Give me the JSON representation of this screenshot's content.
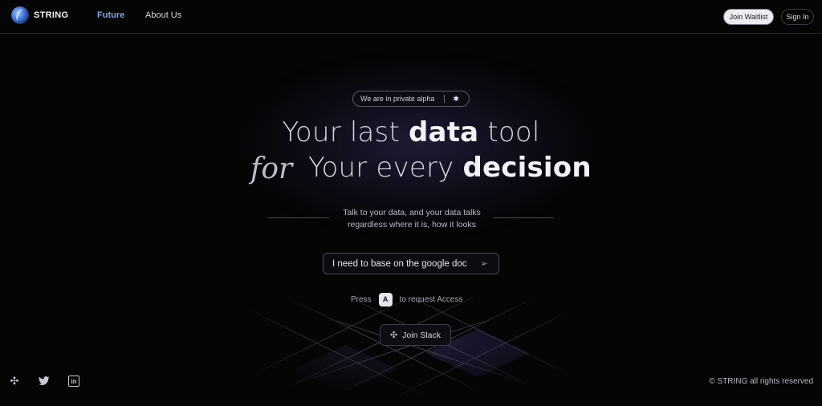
{
  "header": {
    "brand": "STRING",
    "nav": [
      {
        "label": "Future",
        "active": true
      },
      {
        "label": "About Us",
        "active": false
      }
    ],
    "join_waitlist": "Join Waitlist",
    "sign_in": "Sign In"
  },
  "hero": {
    "badge_text": "We are in private alpha",
    "badge_icon": "bug-icon",
    "headline_line1_pre": "Your last ",
    "headline_line1_bold": "data",
    "headline_line1_post": " tool",
    "headline_script": "for",
    "headline_line2_pre": "Your every ",
    "headline_line2_bold": "decision",
    "subtitle_line1": "Talk to your data, and your data talks",
    "subtitle_line2": "regardless where it is, how it looks",
    "input_value": "I need to base on the google doc",
    "press_label": "Press",
    "press_key": "A",
    "press_suffix": "to request Access",
    "join_slack": "Join Slack"
  },
  "footer": {
    "social_icons": [
      "slack-icon",
      "twitter-icon",
      "linkedin-icon"
    ],
    "copyright": "© STRING all rights reserved"
  },
  "colors": {
    "background": "#050506",
    "accent_nav": "#7da5e6",
    "grid_highlight": "#2a2550"
  }
}
